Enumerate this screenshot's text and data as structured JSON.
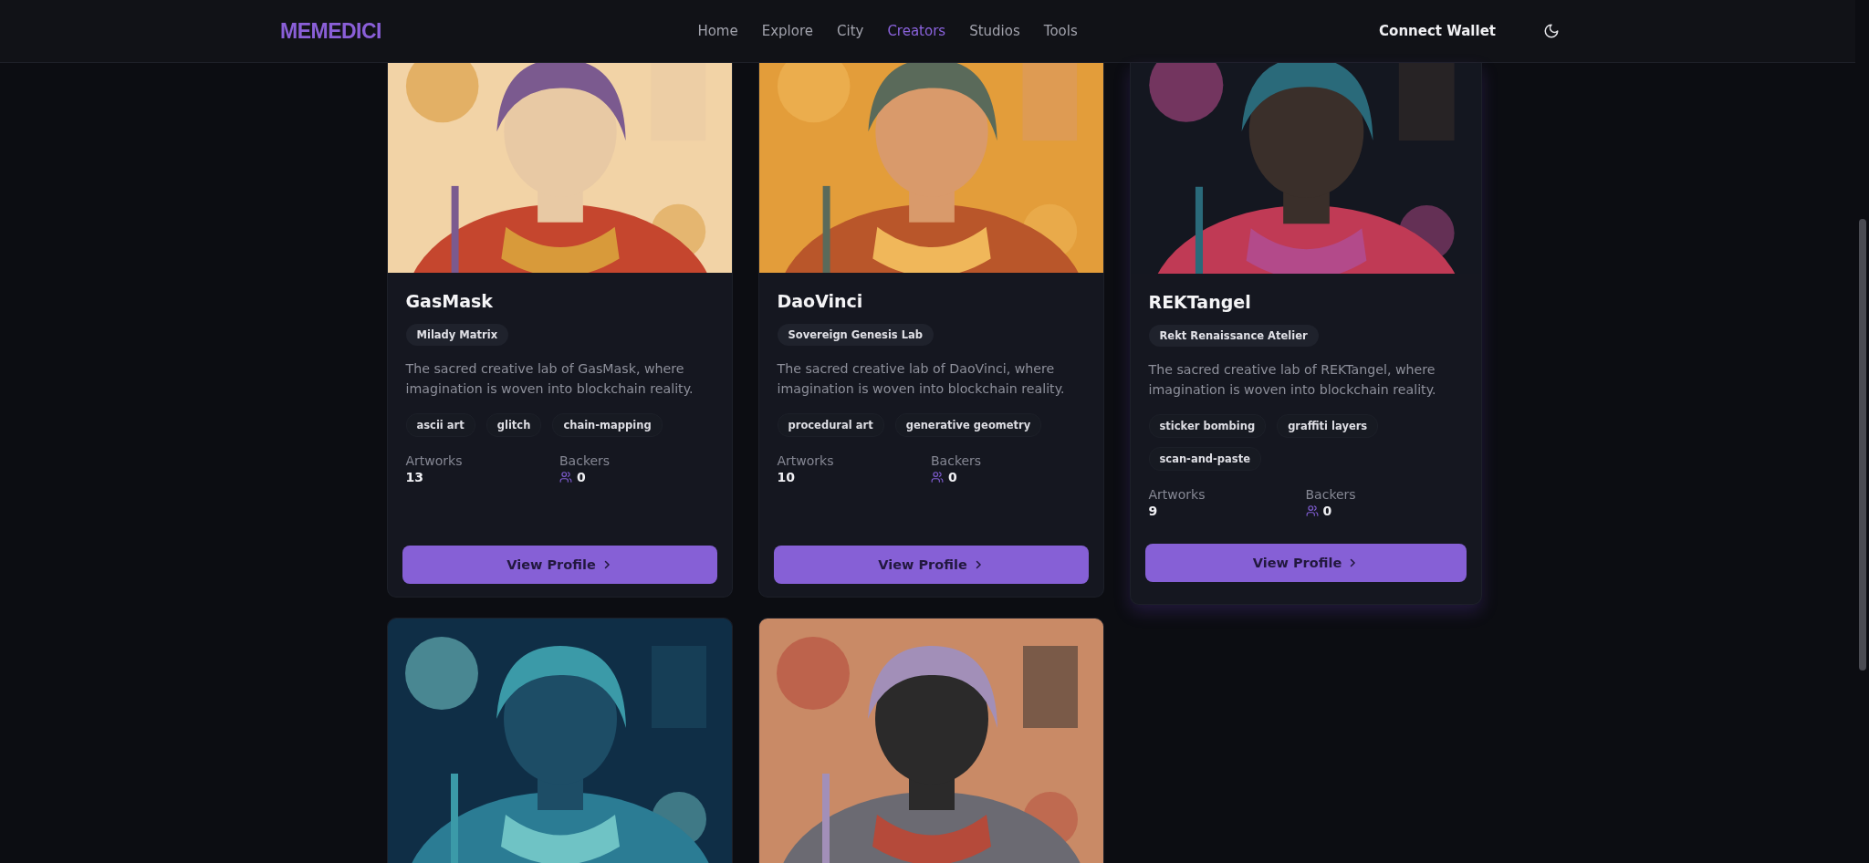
{
  "navbar": {
    "logo": "MEMEDICI",
    "links": [
      {
        "label": "Home",
        "selected": false
      },
      {
        "label": "Explore",
        "selected": false
      },
      {
        "label": "City",
        "selected": false
      },
      {
        "label": "Creators",
        "selected": true
      },
      {
        "label": "Studios",
        "selected": false
      },
      {
        "label": "Tools",
        "selected": false
      }
    ],
    "connect_button": "Connect Wallet"
  },
  "creators": [
    {
      "kind": "card",
      "name": "GasMask",
      "studio": "Milady Matrix",
      "description": "The sacred creative lab of GasMask, where imagination is woven into blockchain reality.",
      "tags": [
        "ascii art",
        "glitch",
        "chain-mapping"
      ],
      "artworks_label": "Artworks",
      "artworks": "13",
      "backers_label": "Backers",
      "backers": "0",
      "button": "View Profile",
      "highlighted": false
    },
    {
      "kind": "card",
      "name": "DaoVinci",
      "studio": "Sovereign Genesis Lab",
      "description": "The sacred creative lab of DaoVinci, where imagination is woven into blockchain reality.",
      "tags": [
        "procedural art",
        "generative geometry"
      ],
      "artworks_label": "Artworks",
      "artworks": "10",
      "backers_label": "Backers",
      "backers": "0",
      "button": "View Profile",
      "highlighted": false
    },
    {
      "kind": "card",
      "name": "REKTangel",
      "studio": "Rekt Renaissance Atelier",
      "description": "The sacred creative lab of REKTangel, where imagination is woven into blockchain reality.",
      "tags": [
        "sticker bombing",
        "graffiti layers",
        "scan-and-paste"
      ],
      "artworks_label": "Artworks",
      "artworks": "9",
      "backers_label": "Backers",
      "backers": "0",
      "button": "View Profile",
      "highlighted": true
    },
    {
      "kind": "picture_only"
    },
    {
      "kind": "picture_only"
    }
  ]
}
